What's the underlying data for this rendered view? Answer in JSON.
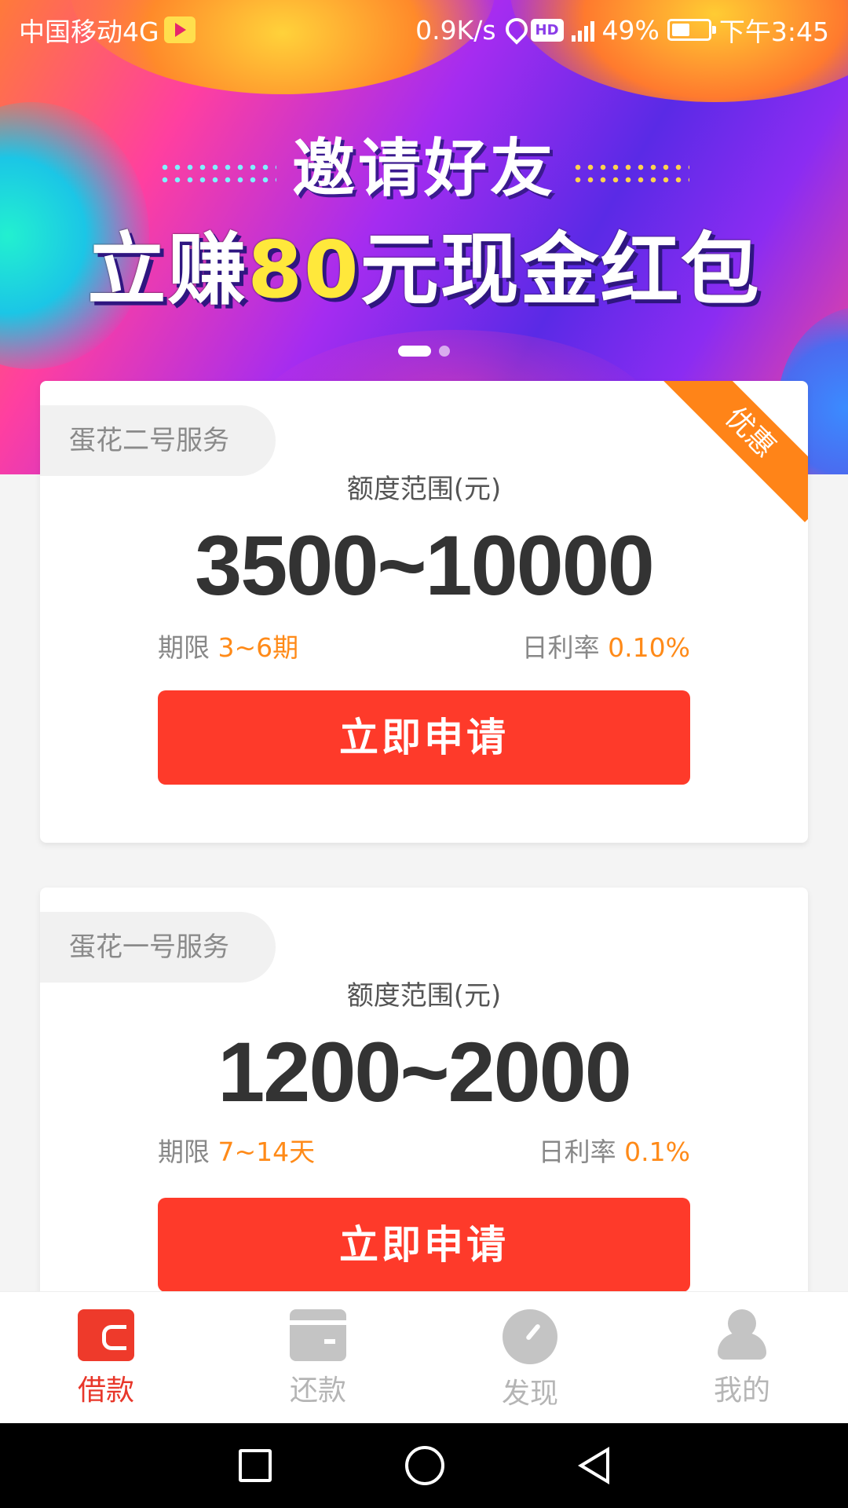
{
  "status_bar": {
    "carrier": "中国移动4G",
    "speed": "0.9K/s",
    "network": "4G",
    "battery": "49%",
    "time": "下午3:45"
  },
  "banner": {
    "title": "邀请好友",
    "subtitle_prefix": "立赚",
    "subtitle_highlight": "80",
    "subtitle_suffix": "元现金红包",
    "slide_count": 2,
    "active_slide": 1
  },
  "products": [
    {
      "service_name": "蛋花二号服务",
      "ribbon": "优惠",
      "range_label": "额度范围(元)",
      "range_value": "3500~10000",
      "term_label": "期限",
      "term_value": "3~6期",
      "rate_label": "日利率",
      "rate_value": "0.10%",
      "apply_label": "立即申请"
    },
    {
      "service_name": "蛋花一号服务",
      "range_label": "额度范围(元)",
      "range_value": "1200~2000",
      "term_label": "期限",
      "term_value": "7~14天",
      "rate_label": "日利率",
      "rate_value": "0.1%",
      "apply_label": "立即申请"
    }
  ],
  "bottom_nav": [
    {
      "label": "借款",
      "icon": "wallet-icon",
      "active": true
    },
    {
      "label": "还款",
      "icon": "card-icon",
      "active": false
    },
    {
      "label": "发现",
      "icon": "compass-icon",
      "active": false
    },
    {
      "label": "我的",
      "icon": "user-icon",
      "active": false
    }
  ],
  "colors": {
    "accent_red": "#fe3a2a",
    "highlight_orange": "#ff8a18",
    "ribbon_orange": "#ff8418",
    "nav_active": "#e8372a"
  }
}
